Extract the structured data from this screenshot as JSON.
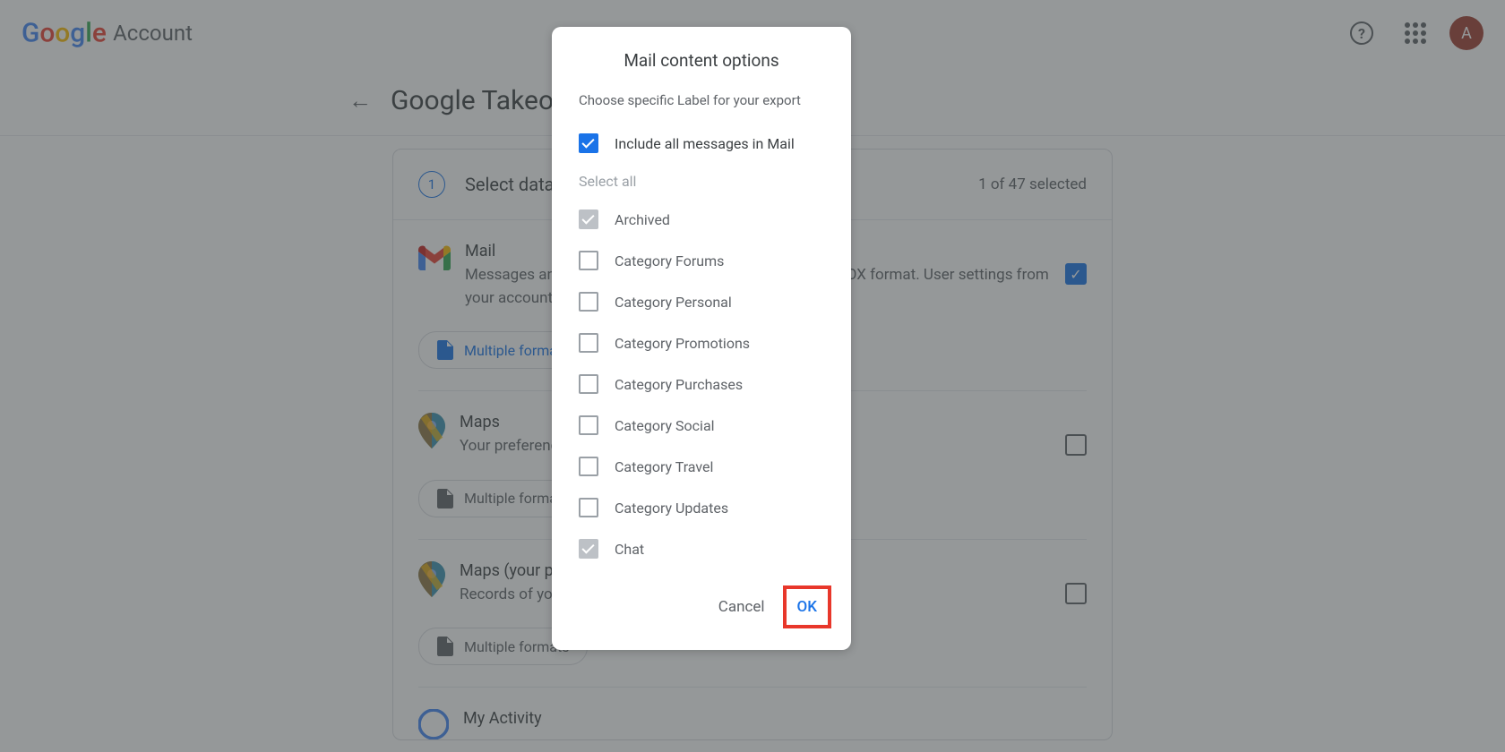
{
  "header": {
    "account_label": "Account",
    "avatar_letter": "A"
  },
  "subheader": {
    "page_title": "Google Takeout"
  },
  "step": {
    "number": "1",
    "title": "Select data to include",
    "count_text": "1 of 47 selected"
  },
  "products": [
    {
      "name": "Mail",
      "desc": "Messages and attachments in your Gmail account in MBOX format. User settings from your account in JSON format.",
      "chip_label": "Multiple formats",
      "checked": true
    },
    {
      "name": "Maps",
      "desc": "Your preferences and personal places in Maps.",
      "chip_label": "Multiple formats",
      "checked": false
    },
    {
      "name": "Maps (your places)",
      "desc": "Records of your starred places and place reviews.",
      "chip_label": "Multiple formats",
      "checked": false
    },
    {
      "name": "My Activity",
      "desc": "",
      "chip_label": "",
      "checked": false
    }
  ],
  "dialog": {
    "title": "Mail content options",
    "subtitle": "Choose specific Label for your export",
    "include_all": "Include all messages in Mail",
    "select_all": "Select all",
    "options": [
      {
        "label": "Archived",
        "state": "checked-disabled"
      },
      {
        "label": "Category Forums",
        "state": "unchecked"
      },
      {
        "label": "Category Personal",
        "state": "unchecked"
      },
      {
        "label": "Category Promotions",
        "state": "unchecked"
      },
      {
        "label": "Category Purchases",
        "state": "unchecked"
      },
      {
        "label": "Category Social",
        "state": "unchecked"
      },
      {
        "label": "Category Travel",
        "state": "unchecked"
      },
      {
        "label": "Category Updates",
        "state": "unchecked"
      },
      {
        "label": "Chat",
        "state": "checked-disabled"
      }
    ],
    "cancel": "Cancel",
    "ok": "OK"
  }
}
